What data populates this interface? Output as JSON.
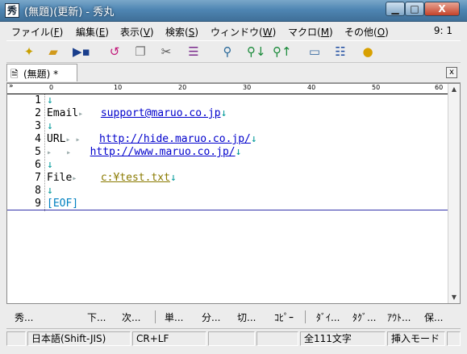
{
  "window": {
    "title": "(無題)(更新) - 秀丸",
    "app_icon_glyph": "秀",
    "minimize": "▁",
    "maximize": "□",
    "close": "X"
  },
  "menu": {
    "items": [
      {
        "label": "ファイル(",
        "key": "F",
        "tail": ")"
      },
      {
        "label": "編集(",
        "key": "E",
        "tail": ")"
      },
      {
        "label": "表示(",
        "key": "V",
        "tail": ")"
      },
      {
        "label": "検索(",
        "key": "S",
        "tail": ")"
      },
      {
        "label": "ウィンドウ(",
        "key": "W",
        "tail": ")"
      },
      {
        "label": "マクロ(",
        "key": "M",
        "tail": ")"
      },
      {
        "label": "その他(",
        "key": "O",
        "tail": ")"
      }
    ],
    "cursor_position": "9: 1"
  },
  "toolbar": {
    "icons": [
      "new-file-icon",
      "open-folder-icon",
      "save-icon",
      "undo-icon",
      "copy-icon",
      "cut-icon",
      "paste-icon",
      "find-icon",
      "find-down-icon",
      "find-up-icon",
      "window-icon",
      "split-window-icon",
      "macro-icon"
    ]
  },
  "tab": {
    "label": "(無題) *",
    "close_glyph": "x"
  },
  "ruler": {
    "labels": [
      "0",
      "10",
      "20",
      "30",
      "40",
      "50",
      "60"
    ],
    "chevron": "»"
  },
  "editor": {
    "lines": [
      {
        "num": "1"
      },
      {
        "num": "2",
        "label": "Email",
        "value": "support@maruo.co.jp",
        "kind": "link"
      },
      {
        "num": "3"
      },
      {
        "num": "4",
        "label": "URL",
        "value": "http://hide.maruo.co.jp/",
        "kind": "link"
      },
      {
        "num": "5",
        "label": "",
        "value": "http://www.maruo.co.jp/",
        "kind": "link"
      },
      {
        "num": "6"
      },
      {
        "num": "7",
        "label": "File",
        "value": "c:¥test.txt",
        "kind": "path"
      },
      {
        "num": "8"
      },
      {
        "num": "9",
        "eof": "[EOF]"
      }
    ],
    "return_mark": "↓"
  },
  "function_keys": [
    "秀...",
    "下...",
    "次...",
    "単...",
    "分...",
    "切...",
    "ｺﾋﾟｰ",
    "ﾀﾞｲ...",
    "ﾀｸﾞ...",
    "ｱｳﾄ...",
    "保..."
  ],
  "status": {
    "encoding": "日本語(Shift-JIS)",
    "newline": "CR+LF",
    "char_count": "全111文字",
    "mode": "挿入モード"
  }
}
